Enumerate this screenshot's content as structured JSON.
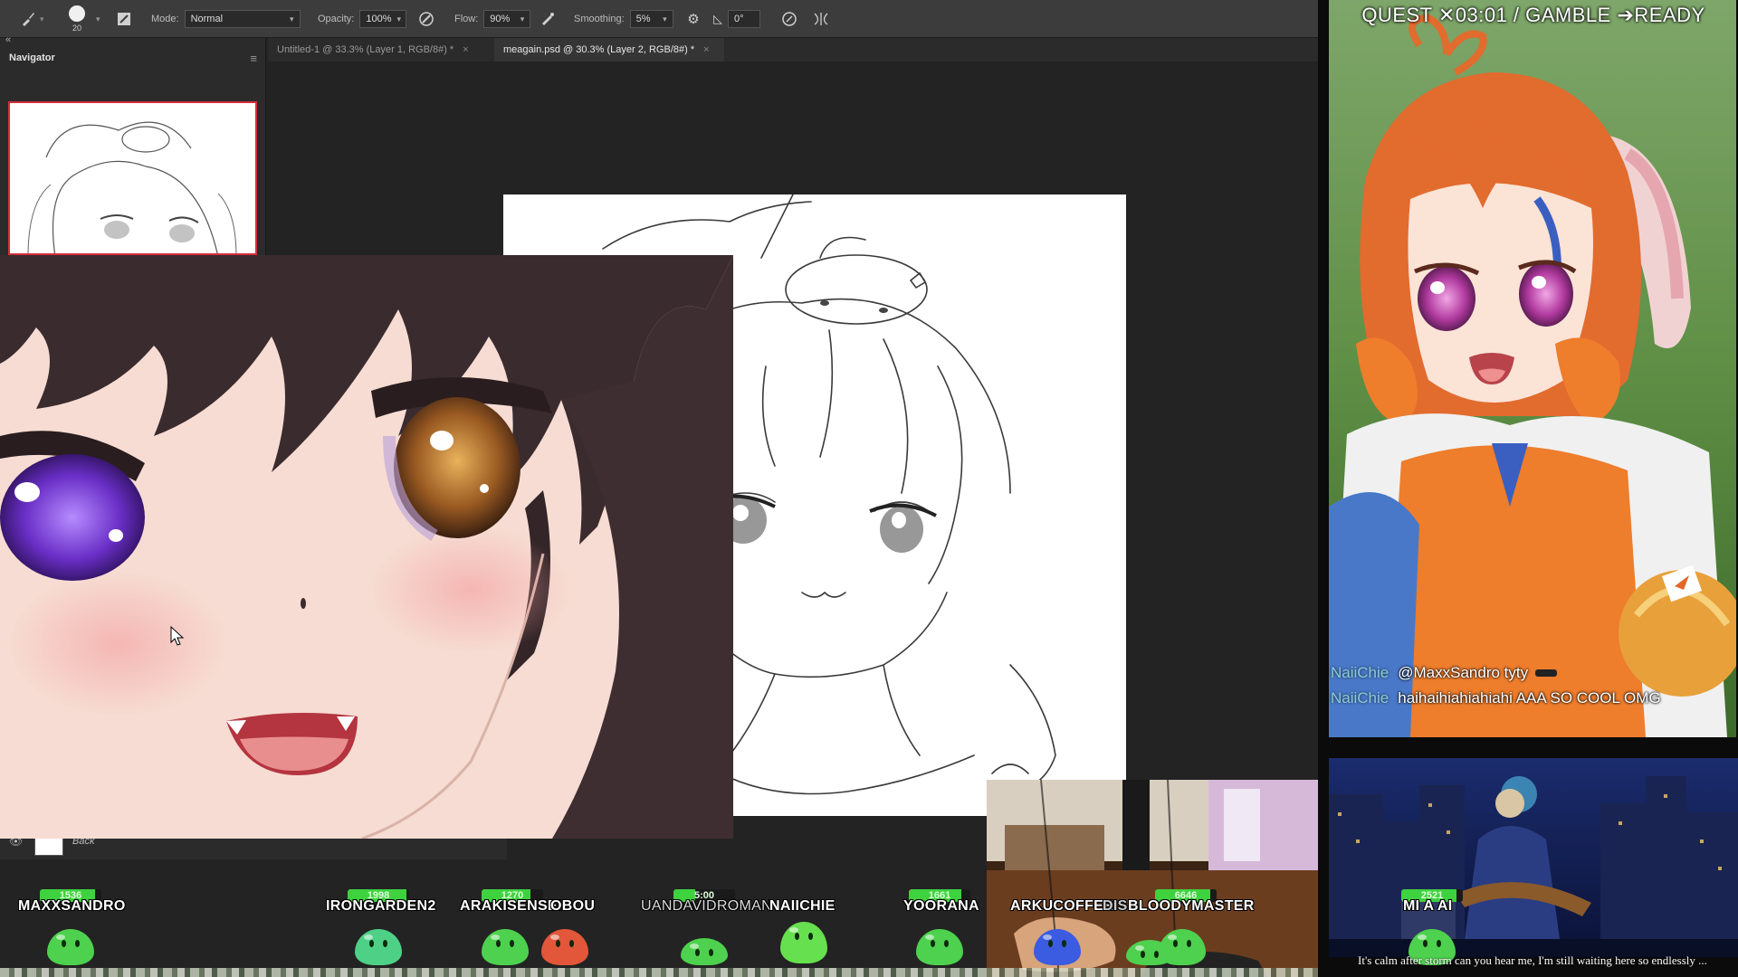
{
  "photoshop": {
    "options_bar": {
      "brush_size": "20",
      "mode_label": "Mode:",
      "mode_value": "Normal",
      "opacity_label": "Opacity:",
      "opacity_value": "100%",
      "flow_label": "Flow:",
      "flow_value": "90%",
      "smoothing_label": "Smoothing:",
      "smoothing_value": "5%",
      "angle_value": "0°",
      "icons": [
        "brush-tool-icon",
        "brush-preset-icon",
        "brush-settings-icon",
        "pressure-opacity-icon",
        "airbrush-icon",
        "smoothing-gear-icon",
        "angle-icon",
        "pressure-size-icon",
        "symmetry-icon"
      ]
    },
    "tabs": [
      {
        "label": "Untitled-1 @ 33.3% (Layer 1, RGB/8#) *",
        "active": false
      },
      {
        "label": "meagain.psd @ 30.3% (Layer 2, RGB/8#) *",
        "active": true
      }
    ],
    "panel": {
      "title": "Navigator",
      "collapse_glyph": "«",
      "menu_glyph": "≡"
    },
    "layer": {
      "name": "Back"
    }
  },
  "stream": {
    "quest_bar": "QUEST ✕03:01  /  GAMBLE ➔READY",
    "chat": [
      {
        "name": "NaiiChie",
        "message": "@MaxxSandro tyty"
      },
      {
        "name": "NaiiChie",
        "message": "haihaihiahiahiahi AAA SO COOL OMG"
      }
    ],
    "marquee": "It's calm after storm can you hear me, I'm still waiting here so endlessly ...",
    "players": [
      {
        "name": "MAXXSANDRO",
        "hp": "1536",
        "hp_frac": 0.9,
        "slime": "#4ed14e"
      },
      {
        "name": "IRONGARDEN2",
        "hp": "1998",
        "hp_frac": 0.95,
        "slime": "#4ed187"
      },
      {
        "name": "ARAKISENSEI",
        "hp": "1270",
        "hp_frac": 0.8,
        "slime": "#4ed14e"
      },
      {
        "name": "OBOU",
        "hp": "",
        "hp_frac": 0.0,
        "slime": "#e2563a"
      },
      {
        "name": "UANDAVIDROMAN",
        "hp": "5:00",
        "hp_frac": 0.35,
        "slime": "#4ed14e"
      },
      {
        "name": "NAIICHIE",
        "hp": "",
        "hp_frac": 0.0,
        "slime": "#66e04e"
      },
      {
        "name": "YOORANA",
        "hp": "1661",
        "hp_frac": 0.85,
        "slime": "#4ed14e"
      },
      {
        "name": "ARKUCOFFEE",
        "hp": "",
        "hp_frac": 0.0,
        "slime": "#3b5be0"
      },
      {
        "name": "DIS",
        "hp": "",
        "hp_frac": 0.0,
        "slime": "#4ed14e"
      },
      {
        "name": "BLOODYMASTER",
        "hp": "6646",
        "hp_frac": 0.9,
        "slime": "#4ed14e"
      },
      {
        "name": "MI A AI",
        "hp": "2521",
        "hp_frac": 0.9,
        "slime": "#4ed14e"
      }
    ]
  }
}
